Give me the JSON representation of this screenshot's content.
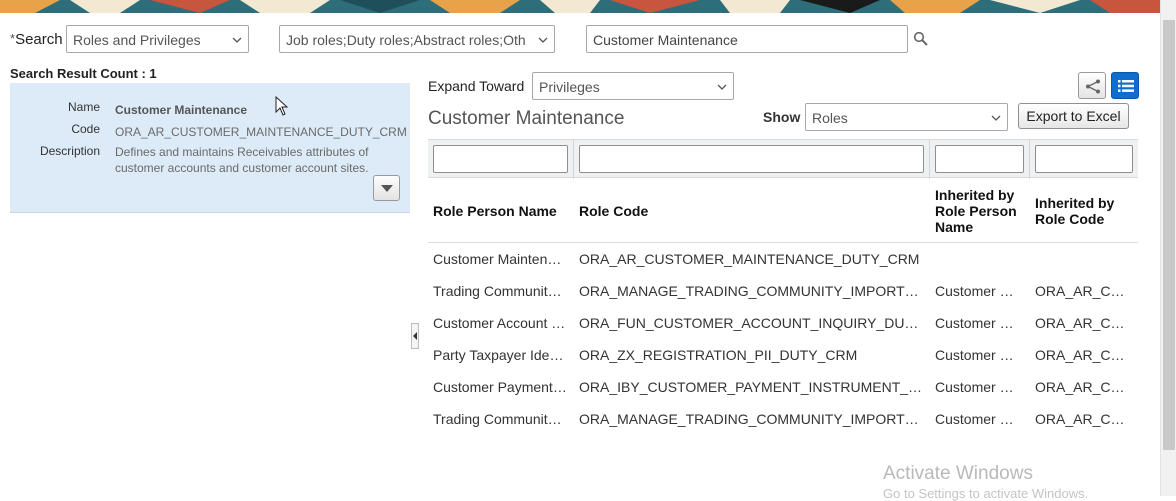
{
  "search": {
    "label": "Search",
    "required_marker": "*",
    "type_select": "Roles and Privileges",
    "role_types_select": "Job roles;Duty roles;Abstract roles;Oth",
    "query_value": "Customer Maintenance"
  },
  "results": {
    "count_label": "Search Result Count : 1",
    "item": {
      "name_key": "Name",
      "name_val": "Customer Maintenance",
      "code_key": "Code",
      "code_val": "ORA_AR_CUSTOMER_MAINTENANCE_DUTY_CRM",
      "desc_key": "Description",
      "desc_line1": "Defines and maintains Receivables attributes of",
      "desc_line2": "customer accounts and customer account sites."
    }
  },
  "panel": {
    "expand_label": "Expand Toward",
    "expand_select": "Privileges",
    "title": "Customer Maintenance",
    "show_label": "Show",
    "show_select": "Roles",
    "export_label": "Export to Excel"
  },
  "table": {
    "headers": {
      "role_person_name": "Role Person Name",
      "role_code": "Role Code",
      "inherited_by_person_name_1": "Inherited by",
      "inherited_by_person_name_2": "Role Person",
      "inherited_by_person_name_3": "Name",
      "inherited_by_code_1": "Inherited by",
      "inherited_by_code_2": "Role Code"
    },
    "rows": [
      {
        "name": "Customer Mainten…",
        "code": "ORA_AR_CUSTOMER_MAINTENANCE_DUTY_CRM",
        "inh_name": "",
        "inh_code": ""
      },
      {
        "name": "Trading Communit…",
        "code": "ORA_MANAGE_TRADING_COMMUNITY_IMPORT…",
        "inh_name": "Customer …",
        "inh_code": "ORA_AR_C…"
      },
      {
        "name": "Customer Account …",
        "code": "ORA_FUN_CUSTOMER_ACCOUNT_INQUIRY_DU…",
        "inh_name": "Customer …",
        "inh_code": "ORA_AR_C…"
      },
      {
        "name": "Party Taxpayer Ide…",
        "code": "ORA_ZX_REGISTRATION_PII_DUTY_CRM",
        "inh_name": "Customer …",
        "inh_code": "ORA_AR_C…"
      },
      {
        "name": "Customer Payment…",
        "code": "ORA_IBY_CUSTOMER_PAYMENT_INSTRUMENT_…",
        "inh_name": "Customer …",
        "inh_code": "ORA_AR_C…"
      },
      {
        "name": "Trading Communit…",
        "code": "ORA_MANAGE_TRADING_COMMUNITY_IMPORT…",
        "inh_name": "Customer …",
        "inh_code": "ORA_AR_C…"
      }
    ]
  },
  "watermark": {
    "line1": "Activate Windows",
    "line2": "Go to Settings to activate Windows."
  },
  "colors": {
    "card_bg": "#dcebf7",
    "accent_blue": "#0f6ecd",
    "banner": "#2d6e7a"
  }
}
